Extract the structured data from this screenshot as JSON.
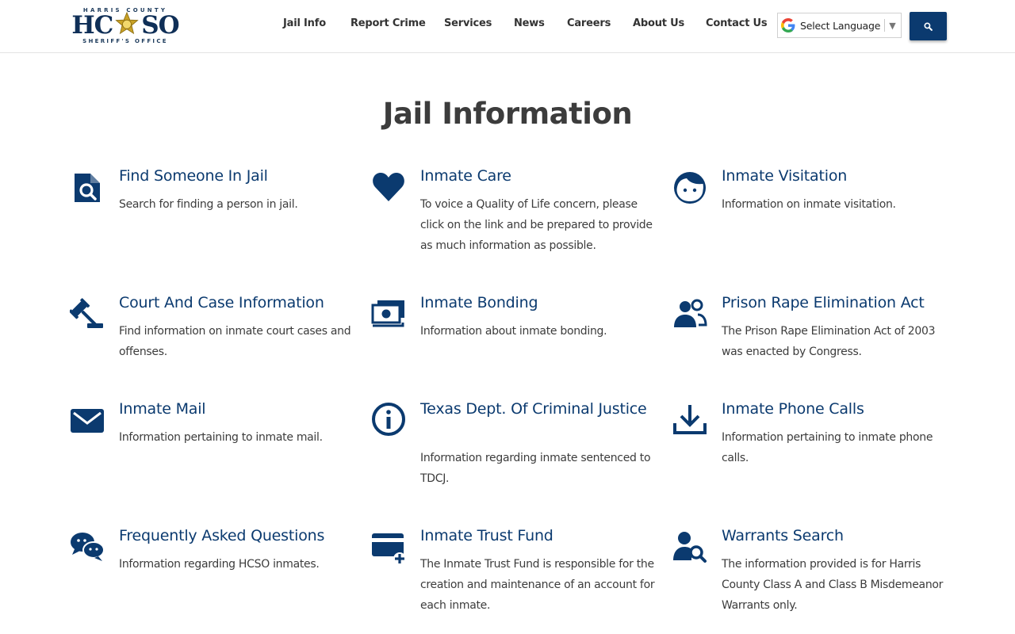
{
  "logo": {
    "top_text": "HARRIS COUNTY",
    "main_left": "HC",
    "main_right": "SO",
    "bottom_text": "SHERIFF'S OFFICE"
  },
  "nav": {
    "items": [
      {
        "label": "Jail Info"
      },
      {
        "label": "Report Crime"
      },
      {
        "label": "Services"
      },
      {
        "label": "News"
      },
      {
        "label": "Careers"
      },
      {
        "label": "About Us"
      },
      {
        "label": "Contact Us"
      }
    ]
  },
  "language": {
    "label": "Select Language"
  },
  "search": {
    "icon": "search-icon"
  },
  "colors": {
    "brand": "#0b3a6f",
    "title": "#3c3c3c"
  },
  "page": {
    "title": "Jail Information"
  },
  "cards": [
    {
      "title": "Find Someone In Jail",
      "desc": "Search for finding a person in jail.",
      "icon": "file-search-icon"
    },
    {
      "title": "Inmate Care",
      "desc": "To voice a Quality of Life concern, please click on the link and be prepared to provide as much information as possible.",
      "icon": "heart-icon"
    },
    {
      "title": "Inmate Visitation",
      "desc": "Information on inmate visitation.",
      "icon": "face-icon"
    },
    {
      "title": "Court And Case Information",
      "desc": "Find information on inmate court cases and offenses.",
      "icon": "gavel-icon"
    },
    {
      "title": "Inmate Bonding",
      "desc": "Information about inmate bonding.",
      "icon": "money-icon"
    },
    {
      "title": "Prison Rape Elimination Act",
      "desc": "The Prison Rape Elimination Act of 2003 was enacted by Congress.",
      "icon": "people-icon"
    },
    {
      "title": "Inmate Mail",
      "desc": "Information pertaining to inmate mail.",
      "icon": "mail-icon"
    },
    {
      "title": "Texas Dept. Of Criminal Justice",
      "desc": "Information regarding inmate sentenced to TDCJ.",
      "icon": "info-icon"
    },
    {
      "title": "Inmate Phone Calls",
      "desc": "Information pertaining to inmate phone calls.",
      "icon": "download-icon"
    },
    {
      "title": "Frequently Asked Questions",
      "desc": "Information regarding HCSO inmates.",
      "icon": "chat-icon"
    },
    {
      "title": "Inmate Trust Fund",
      "desc": "The Inmate Trust Fund is responsible for the creation and maintenance of an account for each inmate.",
      "icon": "card-plus-icon"
    },
    {
      "title": "Warrants Search",
      "desc": "The information provided is for Harris County Class A and Class B Misdemeanor Warrants only.",
      "icon": "person-search-icon"
    }
  ]
}
